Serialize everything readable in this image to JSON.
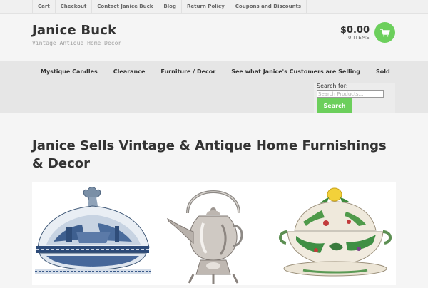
{
  "topbar": {
    "links": [
      "Cart",
      "Checkout",
      "Contact Janice Buck",
      "Blog",
      "Return Policy",
      "Coupons and Discounts"
    ]
  },
  "header": {
    "title": "Janice Buck",
    "tagline": "Vintage Antique Home Decor"
  },
  "cart": {
    "total": "$0.00",
    "items": "0 ITEMS",
    "icon": "shopping-cart-icon"
  },
  "nav": {
    "items": [
      "Mystique Candles",
      "Clearance",
      "Furniture / Decor",
      "See what Janice's Customers are Selling",
      "Sold"
    ]
  },
  "search": {
    "label": "Search for:",
    "placeholder": "Search Products…",
    "button": "Search"
  },
  "main": {
    "title": "Janice Sells Vintage & Antique Home Furnishings & Decor",
    "products": [
      {
        "image": "blue-willow-tureen-image"
      },
      {
        "image": "silver-kettle-image"
      },
      {
        "image": "majolica-tureen-image"
      }
    ]
  },
  "colors": {
    "accent": "#6ccf5c",
    "topbar_bg": "#f0f0f0",
    "nav_bg": "#e6e6e6",
    "page_bg": "#f5f5f5"
  }
}
